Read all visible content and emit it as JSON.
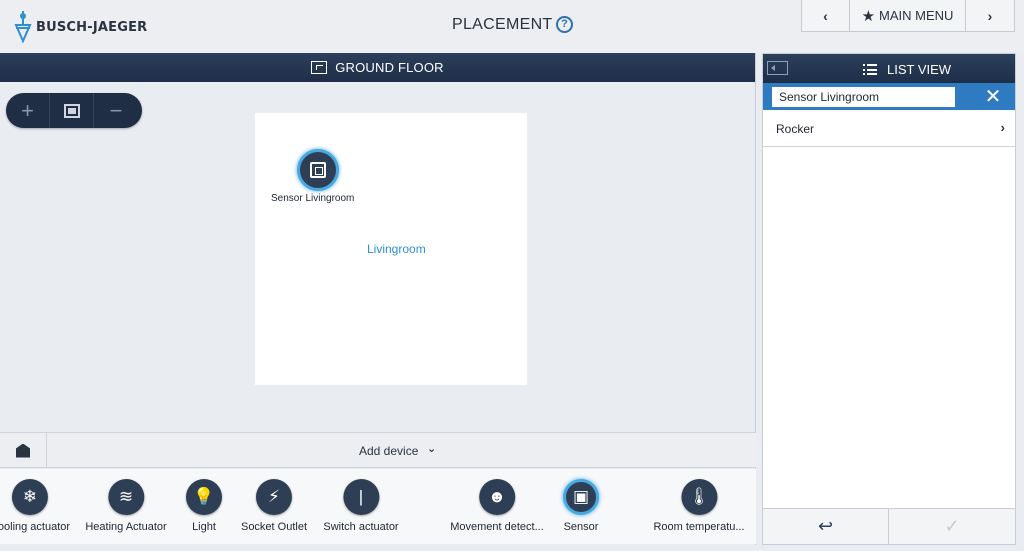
{
  "brand": {
    "name": "BUSCH-JAEGER"
  },
  "header": {
    "title": "PLACEMENT",
    "help_glyph": "?",
    "nav": {
      "prev_glyph": "‹",
      "menu_label": "MAIN MENU",
      "menu_icon": "star-icon",
      "next_glyph": "›"
    }
  },
  "floor": {
    "title": "GROUND FLOOR",
    "zoom": {
      "in": "+",
      "out": "−"
    },
    "room": {
      "label": "Livingroom"
    },
    "placed_device": {
      "label": "Sensor Livingroom",
      "icon": "sensor-icon"
    },
    "add_device_label": "Add device",
    "add_device_chevron": "⌄"
  },
  "palette": [
    {
      "label": "Cooling actuator",
      "icon": "snowflake-icon",
      "glyph": "❄",
      "active": false
    },
    {
      "label": "Heating Actuator",
      "icon": "heating-icon",
      "glyph": "≋",
      "active": false
    },
    {
      "label": "Light",
      "icon": "bulb-icon",
      "glyph": "💡",
      "active": false
    },
    {
      "label": "Socket Outlet",
      "icon": "socket-icon",
      "glyph": "⚡",
      "active": false
    },
    {
      "label": "Switch actuator",
      "icon": "switch-icon",
      "glyph": "|",
      "active": false
    },
    {
      "label": "Movement detect...",
      "icon": "movement-icon",
      "glyph": "☻",
      "active": false
    },
    {
      "label": "Sensor",
      "icon": "sensor-icon",
      "glyph": "▣",
      "active": true
    },
    {
      "label": "Room temperatu...",
      "icon": "thermometer-icon",
      "glyph": "🌡",
      "active": false
    }
  ],
  "list_panel": {
    "title": "LIST VIEW",
    "search_value": "Sensor Livingroom",
    "clear_glyph": "✕",
    "items": [
      {
        "label": "Rocker",
        "chevron": "›"
      }
    ],
    "footer": {
      "back_glyph": "↩",
      "confirm_glyph": "✓"
    }
  },
  "colors": {
    "accent": "#2f7bc1",
    "header_dark": "#1e2e47",
    "device_ring": "#47a8e2",
    "room_label": "#2f8fd0"
  }
}
